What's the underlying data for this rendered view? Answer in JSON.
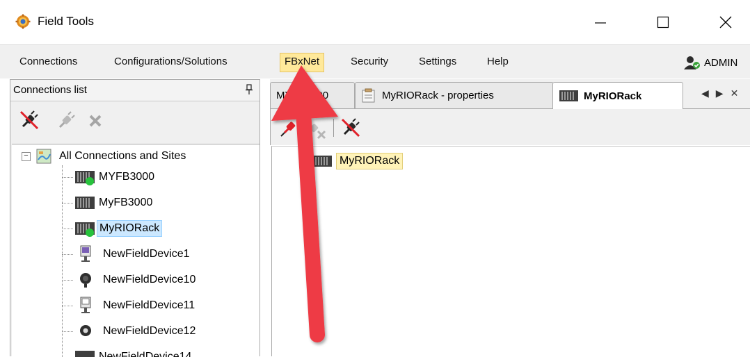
{
  "window": {
    "title": "Field Tools"
  },
  "menu": {
    "items": [
      "Connections",
      "Configurations/Solutions",
      "FBxNet",
      "Security",
      "Settings",
      "Help"
    ],
    "active_index": 2,
    "user": "ADMIN"
  },
  "connections_panel": {
    "title": "Connections list",
    "tree": {
      "root": "All Connections and Sites",
      "items": [
        {
          "label": "MYFB3000",
          "icon": "rack-connected-icon"
        },
        {
          "label": "MyFB3000",
          "icon": "rack-icon"
        },
        {
          "label": "MyRIORack",
          "icon": "rack-connected-icon",
          "selected": true
        },
        {
          "label": "NewFieldDevice1",
          "icon": "field-device-icon"
        },
        {
          "label": "NewFieldDevice10",
          "icon": "dark-sensor-icon"
        },
        {
          "label": "NewFieldDevice11",
          "icon": "field-device-icon"
        },
        {
          "label": "NewFieldDevice12",
          "icon": "dark-sensor-icon"
        },
        {
          "label": "NewFieldDevice14",
          "icon": "rack-icon"
        }
      ]
    }
  },
  "tabs": [
    {
      "label": "MYFB3000",
      "icon": "none"
    },
    {
      "label": "MyRIORack - properties",
      "icon": "properties-icon"
    },
    {
      "label": "MyRIORack",
      "icon": "rack-icon",
      "active": true
    }
  ],
  "canvas": {
    "node_label": "MyRIORack"
  },
  "colors": {
    "menu_highlight": "#ffe99a",
    "selection": "#cce8ff",
    "arrow": "#ee3b45",
    "status_green": "#27c23c"
  }
}
